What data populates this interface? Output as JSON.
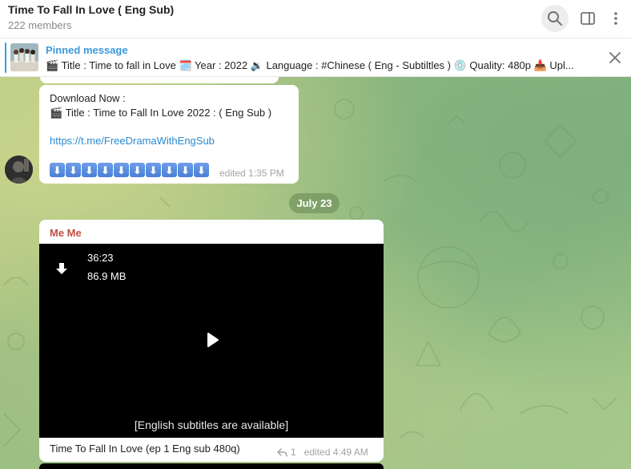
{
  "header": {
    "title": "Time To Fall In Love ( Eng Sub)",
    "members": "222 members",
    "icons": [
      "search-icon",
      "sidebar-toggle-icon",
      "more-vertical-icon"
    ]
  },
  "pinned": {
    "label": "Pinned message",
    "text": "🎬 Title : Time to fall in Love 🗓️ Year : 2022 🔉 Language : #Chinese ( Eng - Subtiltles ) 💿 Quality: 480p 📥 Upl..."
  },
  "messages": [
    {
      "line1": "Download Now :",
      "line2": "🎬 Title : Time to Fall In Love 2022 : ( Eng Sub )",
      "link": "https://t.me/FreeDramaWithEngSub",
      "arrows": [
        "⬇",
        "⬇",
        "⬇",
        "⬇",
        "⬇",
        "⬇",
        "⬇",
        "⬇",
        "⬇",
        "⬇"
      ],
      "meta": "edited 1:35 PM"
    }
  ],
  "date_separator": "July 23",
  "video_message": {
    "sender": "Me Me",
    "duration": "36:23",
    "size": "86.9 MB",
    "subtitle_overlay": "[English subtitles are available]",
    "caption": "Time To Fall In Love (ep 1 Eng sub 480q)",
    "replies": "1",
    "meta": "edited 4:49 AM"
  },
  "colors": {
    "accent": "#3a9bdc",
    "sender": "#c0513f",
    "link": "#2a8ad1",
    "date_pill": "#74965f"
  }
}
